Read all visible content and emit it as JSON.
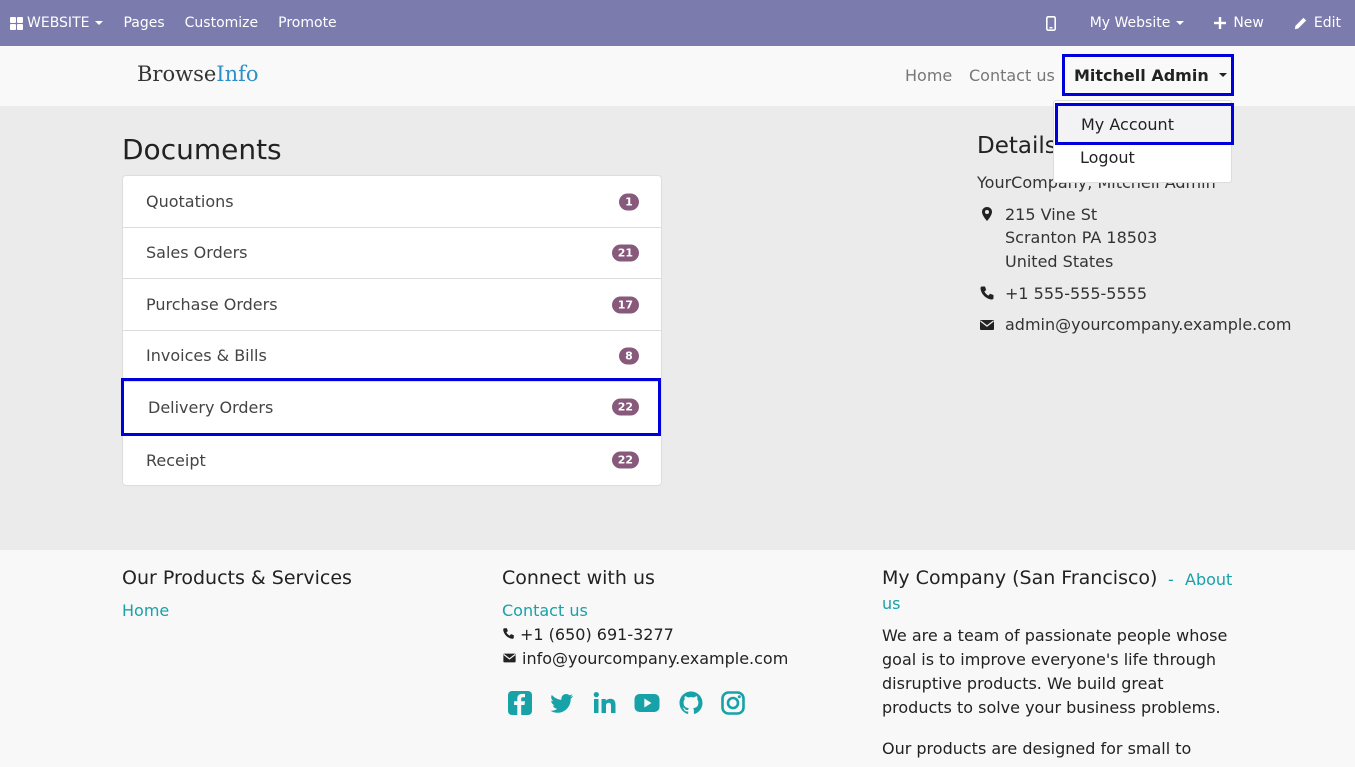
{
  "adminbar": {
    "website": "WEBSITE",
    "pages": "Pages",
    "customize": "Customize",
    "promote": "Promote",
    "my_website": "My Website",
    "new": "New",
    "edit": "Edit"
  },
  "header": {
    "brand_part1": "Browse",
    "brand_part2": "Info",
    "home": "Home",
    "contact": "Contact us",
    "user": "Mitchell Admin"
  },
  "dropdown": {
    "my_account": "My Account",
    "logout": "Logout"
  },
  "documents": {
    "title": "Documents",
    "rows": [
      {
        "label": "Quotations",
        "count": "1"
      },
      {
        "label": "Sales Orders",
        "count": "21"
      },
      {
        "label": "Purchase Orders",
        "count": "17"
      },
      {
        "label": "Invoices & Bills",
        "count": "8"
      },
      {
        "label": "Delivery Orders",
        "count": "22"
      },
      {
        "label": "Receipt",
        "count": "22"
      }
    ]
  },
  "details": {
    "title": "Details",
    "company": "YourCompany, Mitchell Admin",
    "street": "215 Vine St",
    "city": "Scranton PA 18503",
    "country": "United States",
    "phone": "+1 555-555-5555",
    "email": "admin@yourcompany.example.com"
  },
  "footer": {
    "col1_title": "Our Products & Services",
    "col1_home": "Home",
    "col2_title": "Connect with us",
    "col2_contact": "Contact us",
    "col2_phone": "+1 (650) 691-3277",
    "col2_email": "info@yourcompany.example.com",
    "col3_title": "My Company (San Francisco)",
    "col3_dash": " - ",
    "col3_about1": "About",
    "col3_about2": "us",
    "col3_p1_l1": "We are a team of passionate people whose",
    "col3_p1_l2": "goal is to improve everyone's life through",
    "col3_p1_l3": "disruptive products. We build great",
    "col3_p1_l4": "products to solve your business problems.",
    "col3_p2_l1": "Our products are designed for small to",
    "social_icons": [
      "facebook-icon",
      "twitter-icon",
      "linkedin-icon",
      "youtube-icon",
      "github-icon",
      "instagram-icon"
    ]
  },
  "colors": {
    "adminbar": "#7c7bad",
    "accent": "#17a2a8",
    "badge": "#875a7b",
    "highlight": "#0000dd"
  }
}
